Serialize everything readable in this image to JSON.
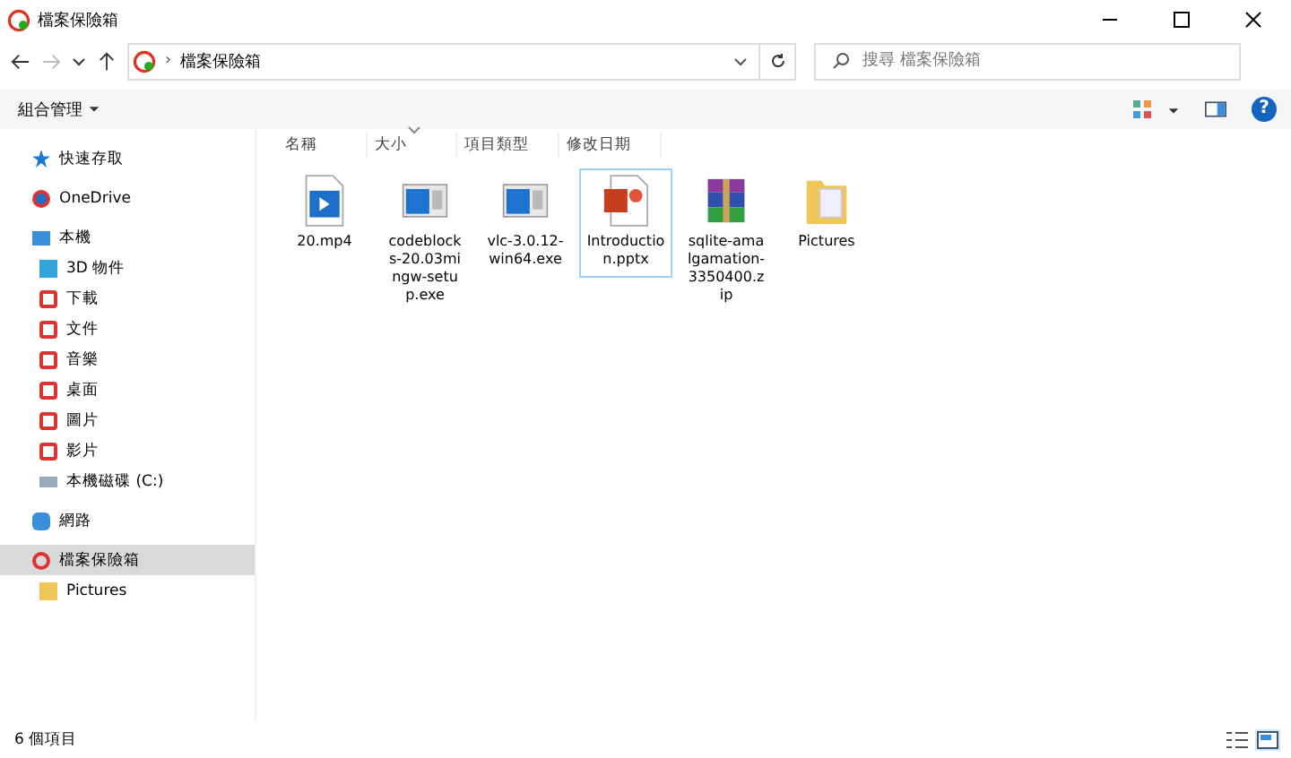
{
  "window": {
    "title": "檔案保險箱"
  },
  "address": {
    "separator": "›",
    "path": "檔案保險箱"
  },
  "search": {
    "placeholder": "搜尋 檔案保險箱"
  },
  "toolbar": {
    "organize": "組合管理",
    "help": "?"
  },
  "columns": [
    {
      "label": "名稱",
      "sorted": false
    },
    {
      "label": "大小",
      "sorted": true
    },
    {
      "label": "項目類型",
      "sorted": false
    },
    {
      "label": "修改日期",
      "sorted": false
    }
  ],
  "sidebar": {
    "items": [
      {
        "label": "快速存取",
        "kind": "star",
        "selected": false
      },
      {
        "label": "OneDrive",
        "kind": "cloud",
        "selected": false
      },
      {
        "label": "本機",
        "kind": "pc",
        "selected": false,
        "children": [
          {
            "label": "3D 物件",
            "kind": "cube",
            "selected": false
          },
          {
            "label": "下載",
            "kind": "shield",
            "selected": false
          },
          {
            "label": "文件",
            "kind": "shield",
            "selected": false
          },
          {
            "label": "音樂",
            "kind": "shield",
            "selected": false
          },
          {
            "label": "桌面",
            "kind": "shield",
            "selected": false
          },
          {
            "label": "圖片",
            "kind": "shield",
            "selected": false
          },
          {
            "label": "影片",
            "kind": "shield",
            "selected": false
          },
          {
            "label": "本機磁碟 (C:)",
            "kind": "drive",
            "selected": false
          }
        ]
      },
      {
        "label": "網路",
        "kind": "network",
        "selected": false
      },
      {
        "label": "檔案保險箱",
        "kind": "vault",
        "selected": true,
        "children": [
          {
            "label": "Pictures",
            "kind": "folder",
            "selected": false
          }
        ]
      }
    ]
  },
  "files": [
    {
      "name": "20.mp4",
      "kind": "video",
      "selected": false
    },
    {
      "name": "codeblocks-20.03mingw-setup.exe",
      "kind": "exe",
      "selected": false
    },
    {
      "name": "vlc-3.0.12-win64.exe",
      "kind": "exe",
      "selected": false
    },
    {
      "name": "Introduction.pptx",
      "kind": "pptx",
      "selected": true
    },
    {
      "name": "sqlite-amalgamation-3350400.zip",
      "kind": "archive",
      "selected": false
    },
    {
      "name": "Pictures",
      "kind": "folder",
      "selected": false
    }
  ],
  "status_bar": {
    "count": "6 個項目",
    "views": [
      {
        "kind": "details",
        "selected": false
      },
      {
        "kind": "large",
        "selected": true
      }
    ]
  }
}
